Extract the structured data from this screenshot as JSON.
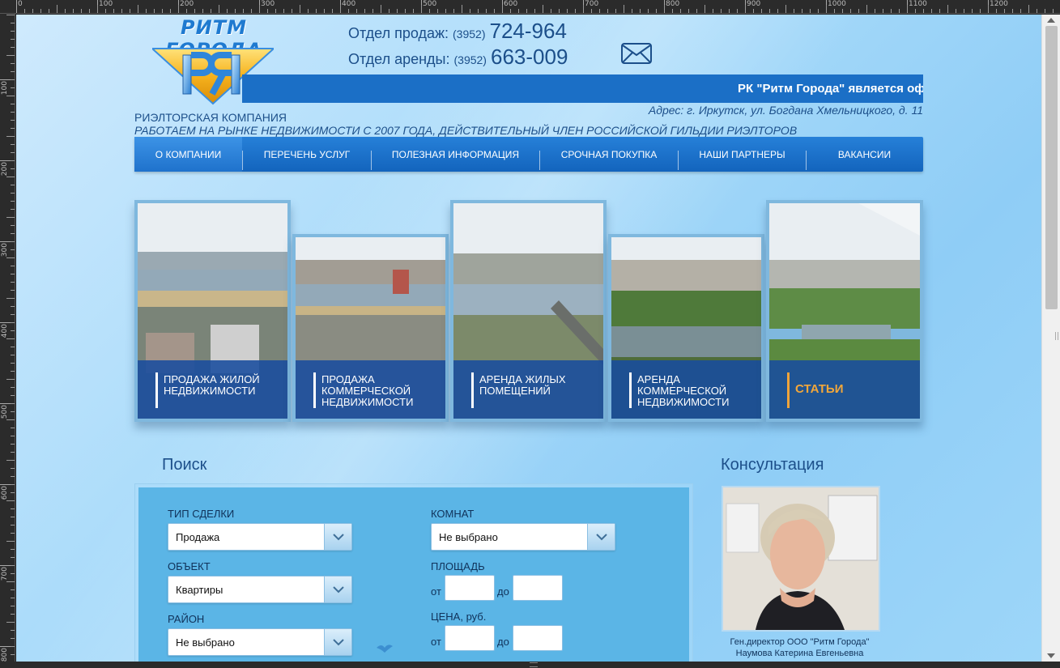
{
  "ruler": {
    "top_labels": [
      "0",
      "100",
      "200",
      "300",
      "400",
      "500",
      "600",
      "700",
      "800",
      "900",
      "1000",
      "1100",
      "1200"
    ],
    "left_labels": [
      "100",
      "200",
      "300",
      "400",
      "500",
      "600",
      "700",
      "800"
    ]
  },
  "header": {
    "logo_text": "РИТМ ГОРОДА",
    "logo_mark": "РЯ",
    "sales_label": "Отдел продаж:",
    "sales_code": "(3952)",
    "sales_number": "724-964",
    "rent_label": "Отдел аренды:",
    "rent_code": "(3952)",
    "rent_number": "663-009",
    "ticker_text": "РК \"Ритм Города\" является офи",
    "address": "Адрес: г. Иркутск, ул. Богдана Хмельницкого, д. 11",
    "company_type": "РИЭЛТОРСКАЯ КОМПАНИЯ",
    "slogan": "РАБОТАЕМ НА РЫНКЕ НЕДВИЖИМОСТИ С 2007 ГОДА, ДЕЙСТВИТЕЛЬНЫЙ ЧЛЕН РОССИЙСКОЙ ГИЛЬДИИ РИЭЛТОРОВ"
  },
  "nav": {
    "items": [
      {
        "label": "О КОМПАНИИ"
      },
      {
        "label": "ПЕРЕЧЕНЬ УСЛУГ"
      },
      {
        "label": "ПОЛЕЗНАЯ ИНФОРМАЦИЯ"
      },
      {
        "label": "СРОЧНАЯ ПОКУПКА"
      },
      {
        "label": "НАШИ ПАРТНЕРЫ"
      },
      {
        "label": "ВАКАНСИИ"
      }
    ]
  },
  "tiles": [
    {
      "line1": "ПРОДАЖА ЖИЛОЙ",
      "line2": "НЕДВИЖИМОСТИ",
      "line3": ""
    },
    {
      "line1": "ПРОДАЖА",
      "line2": "КОММЕРЧЕСКОЙ",
      "line3": "НЕДВИЖИМОСТИ"
    },
    {
      "line1": "АРЕНДА ЖИЛЫХ",
      "line2": "ПОМЕЩЕНИЙ",
      "line3": ""
    },
    {
      "line1": "АРЕНДА",
      "line2": "КОММЕРЧЕСКОЙ",
      "line3": "НЕДВИЖИМОСТИ"
    },
    {
      "line1": "СТАТЬИ",
      "line2": "",
      "line3": ""
    }
  ],
  "search": {
    "title": "Поиск",
    "deal_type_label": "ТИП СДЕЛКИ",
    "deal_type_value": "Продажа",
    "object_label": "ОБЪЕКТ",
    "object_value": "Квартиры",
    "district_label": "РАЙОН",
    "district_value": "Не выбрано",
    "rooms_label": "КОМНАТ",
    "rooms_value": "Не выбрано",
    "area_label": "ПЛОЩАДЬ",
    "price_label": "ЦЕНА, руб.",
    "from": "от",
    "to": "до"
  },
  "consult": {
    "title": "Консультация",
    "caption_role": "Ген.директор ООО \"Ритм Города\"",
    "caption_name": "Наумова Катерина Евгеньевна"
  },
  "colors": {
    "brand_blue": "#1b6fc6",
    "text_dark_blue": "#1c4f8a",
    "accent_gold": "#f3a73a"
  }
}
